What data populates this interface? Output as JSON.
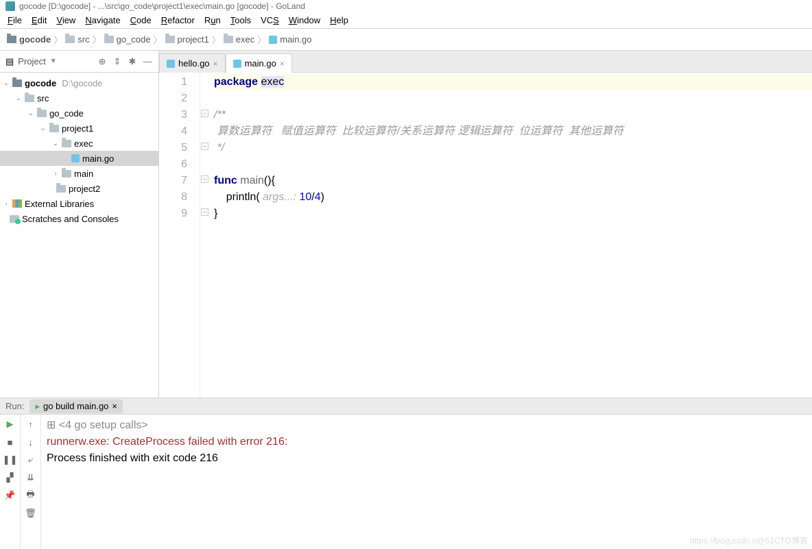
{
  "title": {
    "text": "gocode [D:\\gocode] - ...\\src\\go_code\\project1\\exec\\main.go [gocode] - GoLand"
  },
  "menu": [
    "File",
    "Edit",
    "View",
    "Navigate",
    "Code",
    "Refactor",
    "Run",
    "Tools",
    "VCS",
    "Window",
    "Help"
  ],
  "breadcrumbs": [
    "gocode",
    "src",
    "go_code",
    "project1",
    "exec",
    "main.go"
  ],
  "project": {
    "title": "Project",
    "root": {
      "name": "gocode",
      "path": "D:\\gocode"
    },
    "tree": {
      "src": "src",
      "go_code": "go_code",
      "project1": "project1",
      "exec": "exec",
      "main_go": "main.go",
      "main": "main",
      "project2": "project2"
    },
    "external": "External Libraries",
    "scratches": "Scratches and Consoles"
  },
  "tabs": [
    {
      "label": "hello.go",
      "active": false
    },
    {
      "label": "main.go",
      "active": true
    }
  ],
  "code": {
    "l1_kw": "package",
    "l1_id": "exec",
    "l3": "/**",
    "l4": " 算数运算符   赋值运算符  比较运算符/关系运算符 逻辑运算符  位运算符  其他运算符",
    "l5": " */",
    "l7_kw": "func",
    "l7_fn": "main",
    "l7_rest": "(){",
    "l8_fn": "println",
    "l8_open": "( ",
    "l8_hint": "args...:",
    "l8_num1": "10",
    "l8_op": "/",
    "l8_num2": "4",
    "l8_close": ")",
    "l9": "}"
  },
  "gutter": [
    "1",
    "2",
    "3",
    "4",
    "5",
    "6",
    "7",
    "8",
    "9"
  ],
  "run": {
    "label": "Run:",
    "tab": "go build main.go",
    "line1": "<4 go setup calls>",
    "line2": "runnerw.exe: CreateProcess failed with error 216:",
    "line3": "Process finished with exit code 216"
  },
  "watermark": "https://blog.csdn.n@51CTO博客"
}
